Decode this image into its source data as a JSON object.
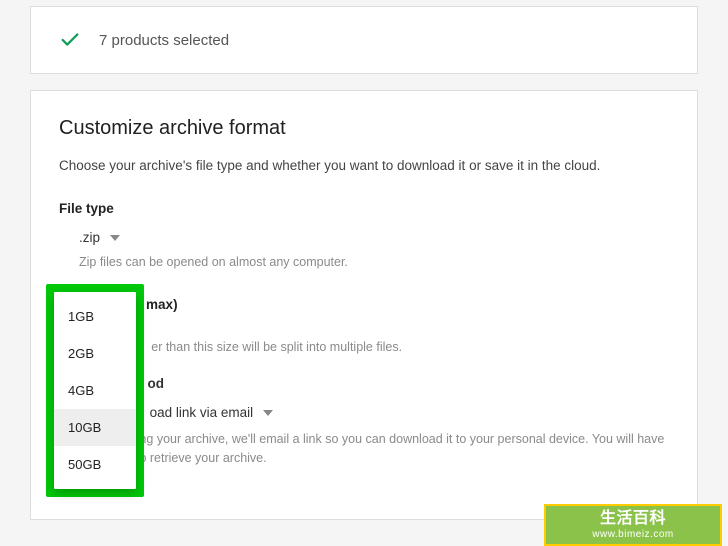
{
  "top": {
    "status_text": "7 products selected"
  },
  "main": {
    "title": "Customize archive format",
    "subtitle": "Choose your archive's file type and whether you want to download it or save it in the cloud.",
    "file_type": {
      "label": "File type",
      "value": ".zip",
      "hint": "Zip files can be opened on almost any computer."
    },
    "archive_size": {
      "label_suffix": "max)",
      "hint_suffix": "er than this size will be split into multiple files.",
      "options": [
        "1GB",
        "2GB",
        "4GB",
        "10GB",
        "50GB"
      ],
      "hovered_index": 3
    },
    "delivery": {
      "label_suffix": "od",
      "value_suffix": "oad link via email",
      "hint": "...ich creating your archive, we'll email a link so you can download it to your personal device. You will have one week to retrieve your archive."
    }
  },
  "watermark": {
    "title": "生活百科",
    "url": "www.bimeiz.com"
  }
}
